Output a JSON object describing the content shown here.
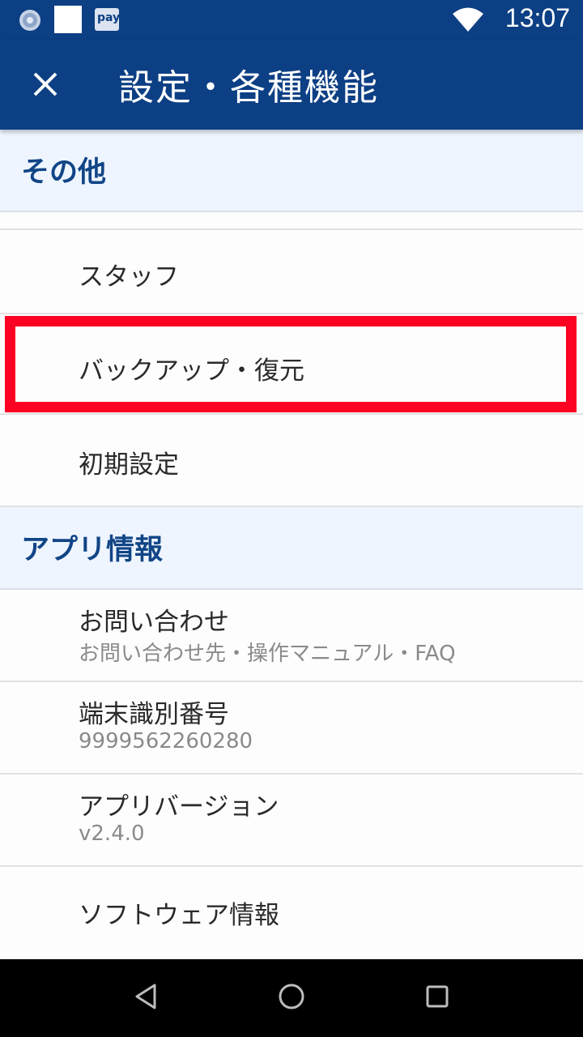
{
  "status_bar": {
    "time": "13:07",
    "icons": [
      "loading-circle-icon",
      "white-square-icon",
      "pay-app-icon",
      "wifi-icon"
    ],
    "pay_icon_text": "pay"
  },
  "app_bar": {
    "title": "設定・各種機能",
    "close_icon": "close-icon"
  },
  "sections": {
    "other": {
      "title": "その他",
      "items": [
        {
          "label": "スタッフ"
        },
        {
          "label": "バックアップ・復元",
          "highlighted": true
        },
        {
          "label": "初期設定"
        }
      ]
    },
    "app_info": {
      "title": "アプリ情報",
      "items": [
        {
          "label": "お問い合わせ",
          "sub": "お問い合わせ先・操作マニュアル・FAQ"
        },
        {
          "label": "端末識別番号",
          "sub": "9999562260280"
        },
        {
          "label": "アプリバージョン",
          "sub": "v2.4.0"
        },
        {
          "label": "ソフトウェア情報"
        }
      ]
    }
  },
  "colors": {
    "primary": "#0c3f84",
    "section_bg": "#eef5fe",
    "section_text": "#114586",
    "highlight": "#fc0223"
  },
  "nav_bar": {
    "icons": [
      "back-triangle-icon",
      "home-circle-icon",
      "recents-square-icon"
    ]
  }
}
